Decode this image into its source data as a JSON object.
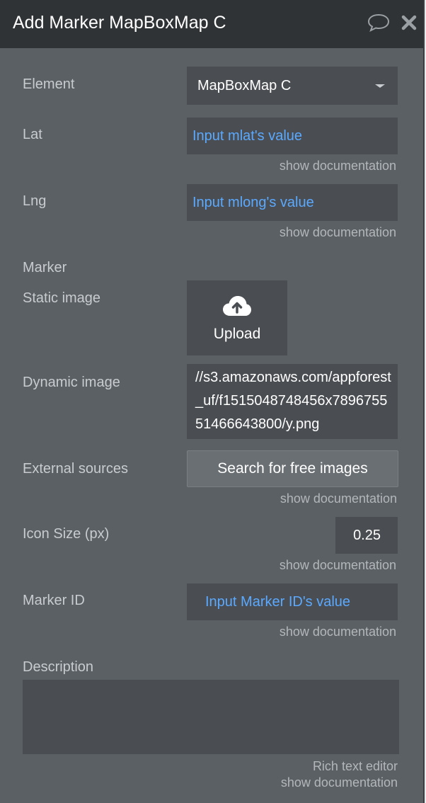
{
  "header": {
    "title": "Add Marker MapBoxMap C",
    "comment_icon": "speech-bubble-icon",
    "close_icon": "close-icon"
  },
  "fields": {
    "element": {
      "label": "Element",
      "value": "MapBoxMap C"
    },
    "lat": {
      "label": "Lat",
      "value": "Input mlat's value",
      "doc": "show documentation"
    },
    "lng": {
      "label": "Lng",
      "value": "Input mlong's value",
      "doc": "show documentation"
    },
    "marker": {
      "label": "Marker"
    },
    "static_image": {
      "label": "Static image",
      "button": "Upload",
      "icon": "cloud-upload-icon"
    },
    "dynamic_image": {
      "label": "Dynamic image",
      "value": "//s3.amazonaws.com/appforest_uf/f1515048748456x789675551466643800/y.png"
    },
    "external_sources": {
      "label": "External sources",
      "button": "Search for free images",
      "doc": "show documentation"
    },
    "icon_size": {
      "label": "Icon Size (px)",
      "value": "0.25",
      "doc": "show documentation"
    },
    "marker_id": {
      "label": "Marker ID",
      "value": "Input Marker ID's value",
      "doc": "show documentation"
    },
    "description": {
      "label": "Description",
      "rich_text": "Rich text editor",
      "doc": "show documentation"
    }
  },
  "colors": {
    "panel_bg": "#5b6064",
    "titlebar_bg": "#2f3336",
    "input_bg": "#4a4e52",
    "dynamic_text": "#5aa9ff",
    "label_text": "#c8cccf"
  }
}
